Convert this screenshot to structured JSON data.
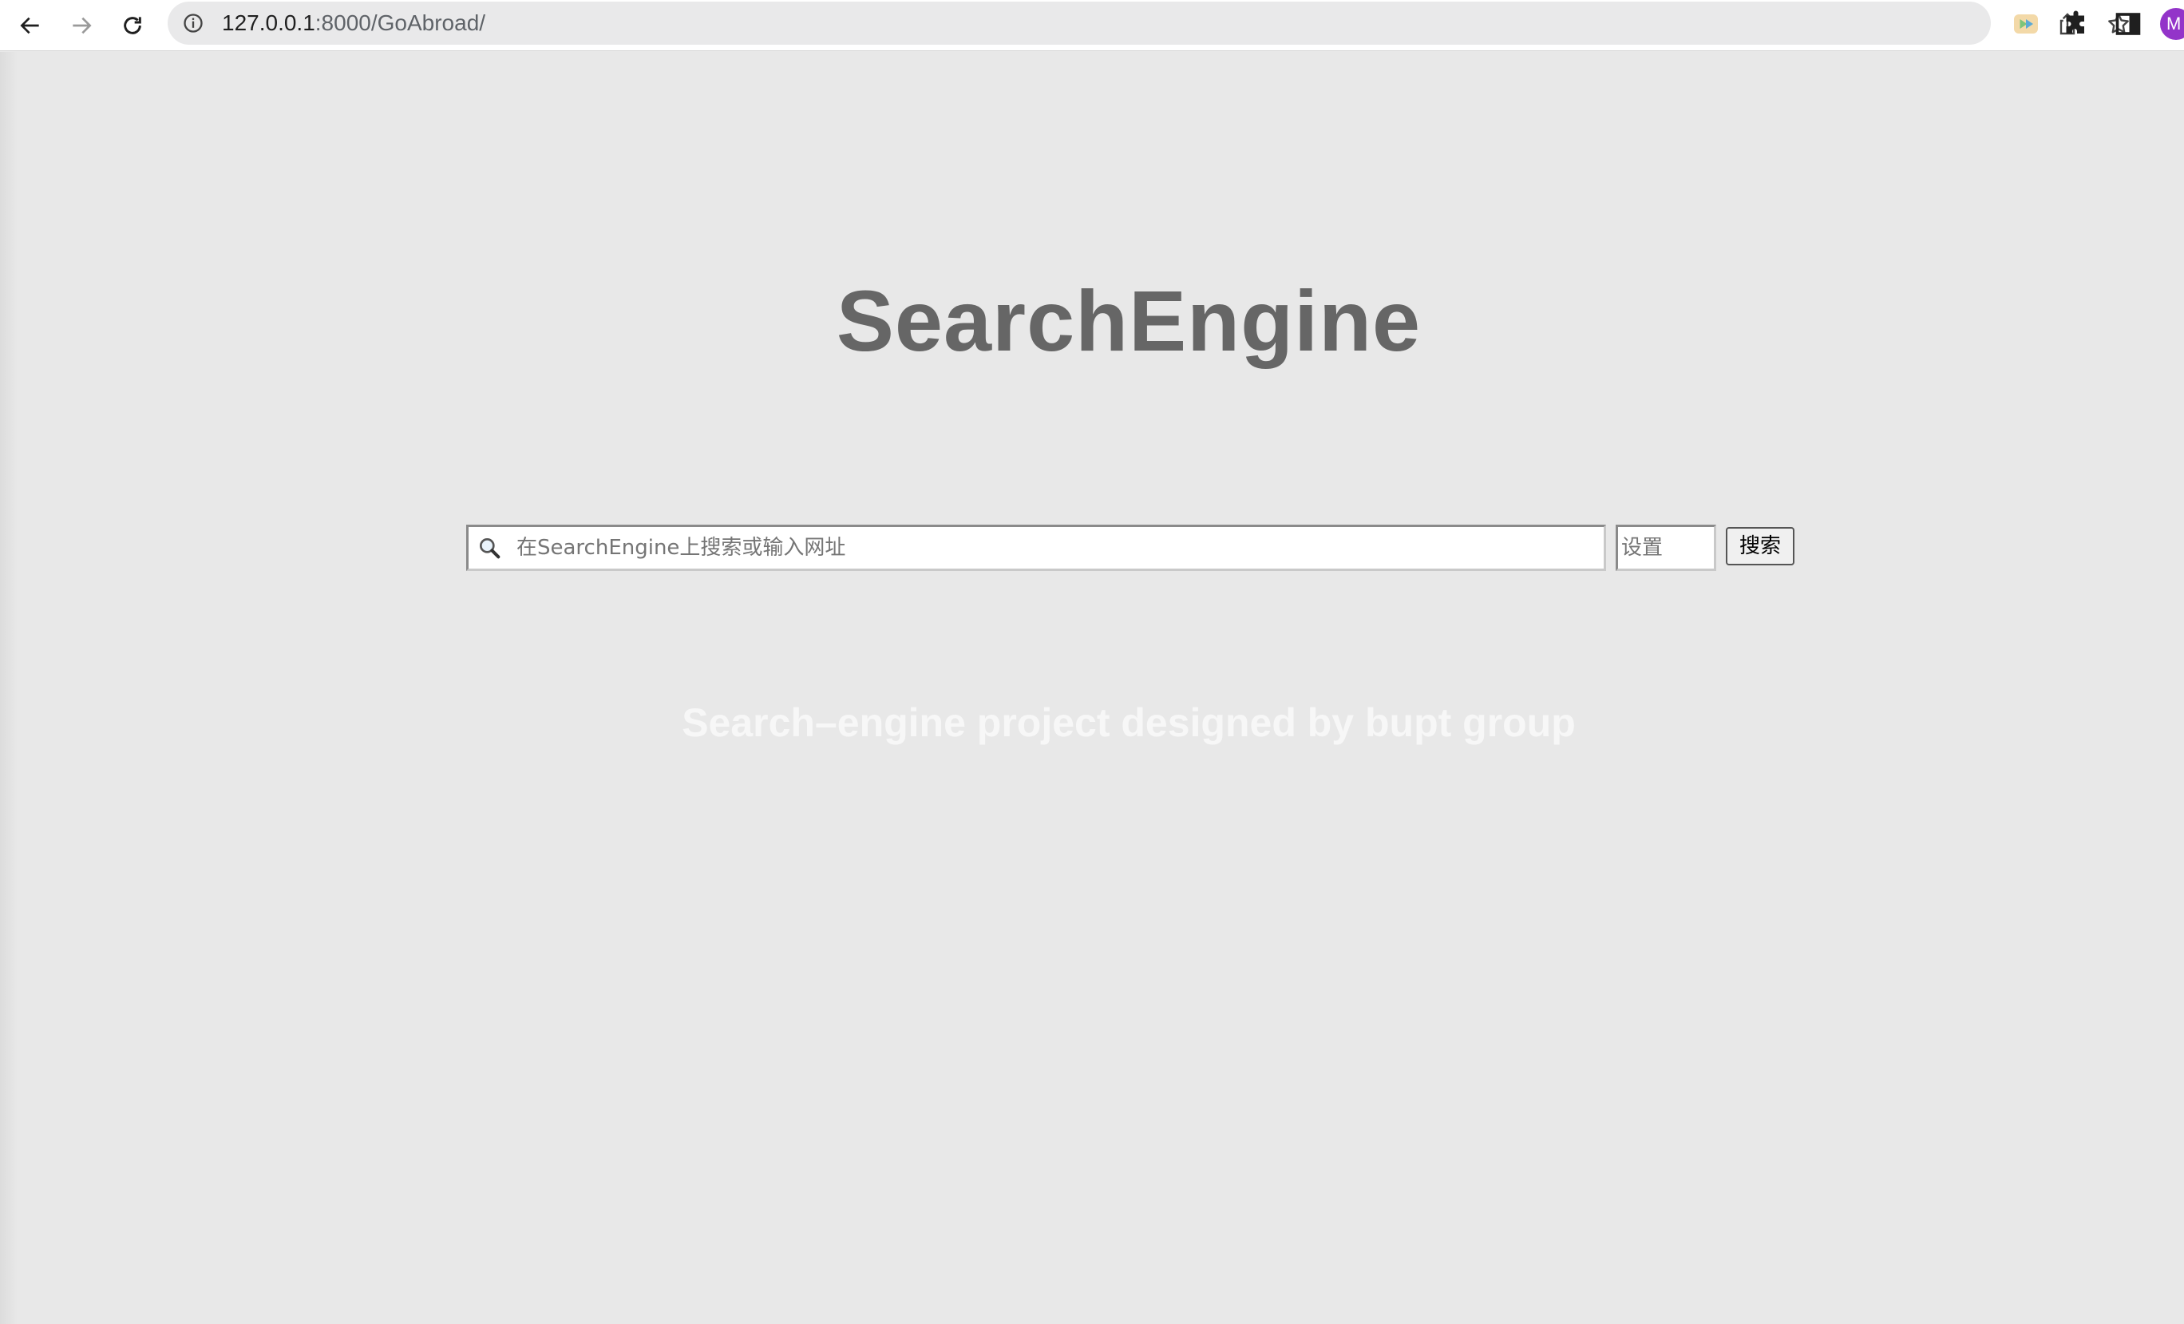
{
  "browser": {
    "url_host": "127.0.0.1",
    "url_rest": ":8000/GoAbroad/",
    "profile_initial": "M",
    "icons": {
      "back": "back-arrow-icon",
      "forward": "forward-arrow-icon",
      "reload": "reload-icon",
      "site_info": "info-icon",
      "share": "share-icon",
      "bookmark": "star-icon",
      "extension": "media-extension-icon",
      "extensions_menu": "puzzle-icon",
      "side_panel": "side-panel-icon"
    }
  },
  "page": {
    "title": "SearchEngine",
    "search": {
      "placeholder": "在SearchEngine上搜索或输入网址",
      "value": ""
    },
    "settings": {
      "placeholder": "设置",
      "value": ""
    },
    "search_button_label": "搜索",
    "tagline": "Search–engine project designed by bupt group"
  },
  "colors": {
    "page_background": "#e8e8e8",
    "title": "#666666",
    "tagline": "#f7f7f7",
    "avatar": "#9334c9"
  }
}
